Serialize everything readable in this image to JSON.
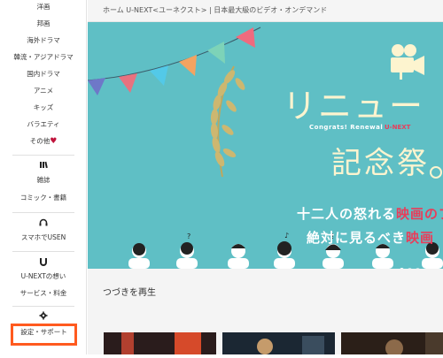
{
  "sidebar": {
    "items": [
      {
        "label": "洋画"
      },
      {
        "label": "邦画"
      },
      {
        "label": "海外ドラマ"
      },
      {
        "label": "韓流・アジアドラマ"
      },
      {
        "label": "国内ドラマ"
      },
      {
        "label": "アニメ"
      },
      {
        "label": "キッズ"
      },
      {
        "label": "バラエティ"
      },
      {
        "label": "その他"
      },
      {
        "label": "雑誌"
      },
      {
        "label": "コミック・書籍"
      },
      {
        "label": "スマホでUSEN"
      },
      {
        "label": "U-NEXTの想い"
      },
      {
        "label": "サービス・料金"
      },
      {
        "label": "設定・サポート"
      }
    ],
    "heart": "♥",
    "icons": [
      "book-icon",
      "headphones-icon",
      "u-next-logo-icon",
      "gear-icon"
    ]
  },
  "breadcrumb": {
    "text": "ホーム  U-NEXT<ユーネクスト> | 日本最大級のビデオ・オンデマンド"
  },
  "hero": {
    "title": "リニュー",
    "subtitle": "Congrats! Renewal",
    "subtitle_accent": "U-NEXT",
    "big_text": "記念祭",
    "line1_pre": "十二人の怒れる",
    "line1_hl": "映画のプ",
    "line2_pre": "絶対に見るべき",
    "line2_hl": "映画",
    "colors": {
      "background": "#5fbfc5",
      "title": "#fdf4cf",
      "accent": "#e83d5a"
    }
  },
  "continue_section": {
    "title": "つづきを再生"
  },
  "highlight_color": "#ff5a1f"
}
